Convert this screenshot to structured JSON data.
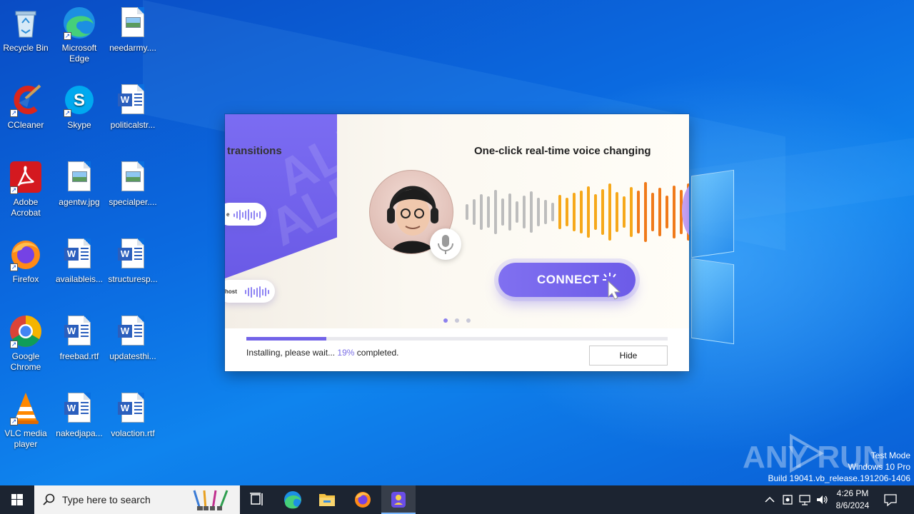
{
  "desktop_icons": [
    {
      "label": "Recycle Bin",
      "icon": "recycle-bin-icon"
    },
    {
      "label": "Microsoft Edge",
      "icon": "edge-icon"
    },
    {
      "label": "needarmy....",
      "icon": "image-file-icon"
    },
    {
      "label": "CCleaner",
      "icon": "ccleaner-icon"
    },
    {
      "label": "Skype",
      "icon": "skype-icon"
    },
    {
      "label": "politicalstr...",
      "icon": "word-doc-icon"
    },
    {
      "label": "Adobe Acrobat",
      "icon": "acrobat-icon"
    },
    {
      "label": "agentw.jpg",
      "icon": "image-file-icon"
    },
    {
      "label": "specialper....",
      "icon": "image-file-icon"
    },
    {
      "label": "Firefox",
      "icon": "firefox-icon"
    },
    {
      "label": "availableis...",
      "icon": "word-doc-icon"
    },
    {
      "label": "structuresp...",
      "icon": "word-doc-icon"
    },
    {
      "label": "Google Chrome",
      "icon": "chrome-icon"
    },
    {
      "label": "freebad.rtf",
      "icon": "word-doc-icon"
    },
    {
      "label": "updatesthi...",
      "icon": "word-doc-icon"
    },
    {
      "label": "VLC media player",
      "icon": "vlc-icon"
    },
    {
      "label": "nakedjapa...",
      "icon": "word-doc-icon"
    },
    {
      "label": "volaction.rtf",
      "icon": "word-doc-icon"
    }
  ],
  "installer": {
    "slide_left_title": "transitions",
    "slide_title": "One-click real-time voice changing",
    "chip_top_text": "e",
    "chip_bottom_text": "host",
    "connect_label": "CONNECT",
    "carousel_dots": 3,
    "active_dot": 0,
    "progress_percent": 19,
    "status_prefix": "Installing, please wait...",
    "status_percent": "19%",
    "status_suffix": "completed.",
    "hide_label": "Hide",
    "accent_color": "#7263e8"
  },
  "watermark": {
    "brand": "ANY RUN",
    "line1": "Test Mode",
    "line2": "Windows 10 Pro",
    "line3": "Build 19041.vb_release.191206-1406"
  },
  "taskbar": {
    "search_placeholder": "Type here to search",
    "time": "4:26 PM",
    "date": "8/6/2024",
    "pinned": [
      "task-view-icon",
      "edge-icon",
      "file-explorer-icon",
      "firefox-icon",
      "voice-changer-app-icon"
    ]
  }
}
